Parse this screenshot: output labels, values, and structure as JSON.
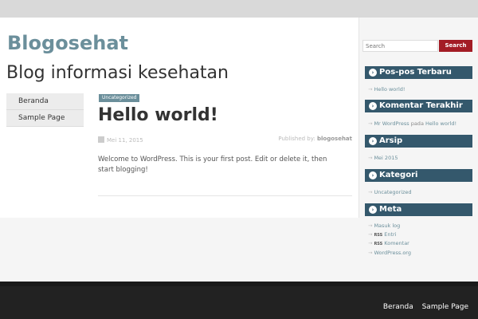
{
  "site": {
    "title": "Blogosehat",
    "description": "Blog informasi kesehatan"
  },
  "nav": {
    "items": [
      {
        "label": "Beranda"
      },
      {
        "label": "Sample Page"
      }
    ]
  },
  "post": {
    "category": "Uncategorized",
    "title": "Hello world!",
    "date": "Mei 11, 2015",
    "author_prefix": "Published by:",
    "author": "blogosehat",
    "content": "Welcome to WordPress. This is your first post. Edit or delete it, then start blogging!"
  },
  "search": {
    "placeholder": "Search",
    "button_label": "Search"
  },
  "widgets": {
    "recent_posts": {
      "title": "Pos-pos Terbaru",
      "items": [
        "Hello world!"
      ]
    },
    "recent_comments": {
      "title": "Komentar Terakhir",
      "commenter": "Mr WordPress",
      "joiner": "pada",
      "post": "Hello world!"
    },
    "archives": {
      "title": "Arsip",
      "items": [
        "Mei 2015"
      ]
    },
    "categories": {
      "title": "Kategori",
      "items": [
        "Uncategorized"
      ]
    },
    "meta": {
      "title": "Meta",
      "login": "Masuk log",
      "rss_label": "RSS",
      "entries": "Entri",
      "comments": "Komentar",
      "wp": "WordPress.org"
    }
  },
  "footer": {
    "items": [
      {
        "label": "Beranda"
      },
      {
        "label": "Sample Page"
      }
    ]
  },
  "colors": {
    "accent": "#6b8f9b",
    "widget_header": "#34586c",
    "search_button": "#a31c25",
    "footer": "#222222"
  },
  "icons": {
    "calendar": "calendar-icon",
    "widget_arrow": "circle-arrow-right-icon"
  }
}
